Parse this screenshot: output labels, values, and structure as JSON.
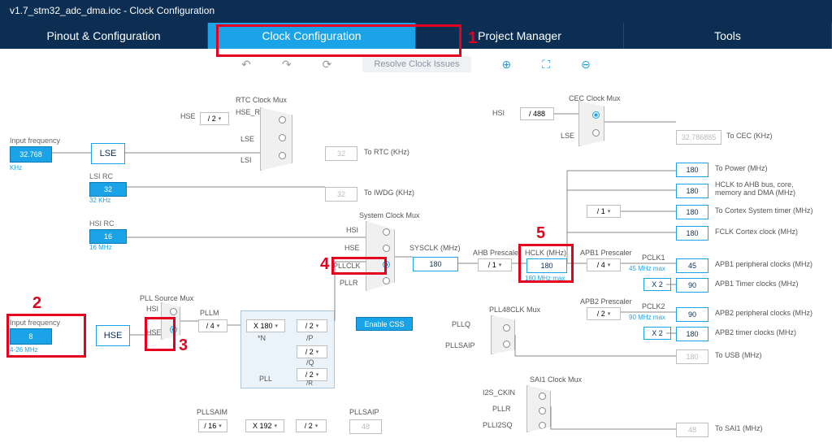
{
  "title": "v1.7_stm32_adc_dma.ioc - Clock Configuration",
  "tabs": [
    "Pinout & Configuration",
    "Clock Configuration",
    "Project Manager",
    "Tools"
  ],
  "active_tab": 1,
  "toolbar": {
    "resolve": "Resolve Clock Issues"
  },
  "marks": {
    "m1": "1",
    "m2": "2",
    "m3": "3",
    "m4": "4",
    "m5": "5"
  },
  "lse": {
    "label": "Input frequency",
    "val": "32.768",
    "unit": "KHz",
    "name": "LSE"
  },
  "hse": {
    "label": "Input frequency",
    "val": "8",
    "range": "4-26 MHz",
    "name": "HSE"
  },
  "lsi": {
    "title": "LSI RC",
    "val": "32",
    "unit": "32 KHz"
  },
  "hsi": {
    "title": "HSI RC",
    "val": "16",
    "unit": "16 MHz"
  },
  "rtc": {
    "title": "RTC Clock Mux",
    "hse_div": "/ 2",
    "hse_rtc": "HSE_RTC",
    "lbl_hse": "HSE",
    "lbl_lse": "LSE",
    "lbl_lsi": "LSI",
    "out_val": "32",
    "out_txt": "To RTC (KHz)"
  },
  "iwdg": {
    "val": "32",
    "txt": "To IWDG (KHz)"
  },
  "pllsrc": {
    "title": "PLL Source Mux",
    "hsi": "HSI",
    "hse": "HSE"
  },
  "pll": {
    "m_lbl": "PLLM",
    "m": "/ 4",
    "n_lbl": "*N",
    "n": "X 180",
    "p_lbl": "/P",
    "p": "/ 2",
    "q_lbl": "/Q",
    "q": "/ 2",
    "r_lbl": "/R",
    "r": "/ 2",
    "name": "PLL"
  },
  "pllsai": {
    "m_lbl": "PLLSAIM",
    "m": "/ 16",
    "n": "X 192",
    "q": "/ 2",
    "p_lbl": "PLLSAIP",
    "p": "48"
  },
  "sysmux": {
    "title": "System Clock Mux",
    "hsi": "HSI",
    "hse": "HSE",
    "pllclk": "PLLCLK",
    "pllr": "PLLR",
    "sysclk": "SYSCLK (MHz)",
    "val": "180",
    "css": "Enable CSS"
  },
  "ahb": {
    "lbl": "AHB Prescaler",
    "val": "/ 1"
  },
  "hclk": {
    "lbl": "HCLK (MHz)",
    "val": "180",
    "max": "180 MHz max"
  },
  "cortex": {
    "div": "/ 1"
  },
  "apb1": {
    "lbl": "APB1 Prescaler",
    "val": "/ 4",
    "pclk": "PCLK1",
    "max": "45 MHz max",
    "tim": "X 2"
  },
  "apb2": {
    "lbl": "APB2 Prescaler",
    "val": "/ 2",
    "pclk": "PCLK2",
    "max": "90 MHz max",
    "tim": "X 2"
  },
  "outputs": {
    "power": {
      "val": "180",
      "txt": "To Power (MHz)"
    },
    "ahb": {
      "val": "180",
      "txt": "HCLK to AHB bus, core, memory and DMA (MHz)"
    },
    "systick": {
      "val": "180",
      "txt": "To Cortex System timer (MHz)"
    },
    "fclk": {
      "val": "180",
      "txt": "FCLK Cortex clock (MHz)"
    },
    "apb1p": {
      "val": "45",
      "txt": "APB1 peripheral clocks (MHz)"
    },
    "apb1t": {
      "val": "90",
      "txt": "APB1 Timer clocks (MHz)"
    },
    "apb2p": {
      "val": "90",
      "txt": "APB2 peripheral clocks (MHz)"
    },
    "apb2t": {
      "val": "180",
      "txt": "APB2 timer clocks (MHz)"
    },
    "usb": {
      "val": "180",
      "txt": "To USB (MHz)"
    },
    "sai1": {
      "val": "48",
      "txt": "To SAI1 (MHz)"
    }
  },
  "cec": {
    "title": "CEC Clock Mux",
    "hsi": "HSI",
    "lse": "LSE",
    "div": "/ 488",
    "out": "32.786885",
    "txt": "To CEC (KHz)"
  },
  "pll48": {
    "title": "PLL48CLK Mux",
    "q": "PLLQ",
    "saip": "PLLSAIP"
  },
  "sai1": {
    "title": "SAI1 Clock Mux",
    "i2s": "I2S_CKIN",
    "pllr": "PLLR",
    "pllisq": "PLLI2SQ"
  }
}
